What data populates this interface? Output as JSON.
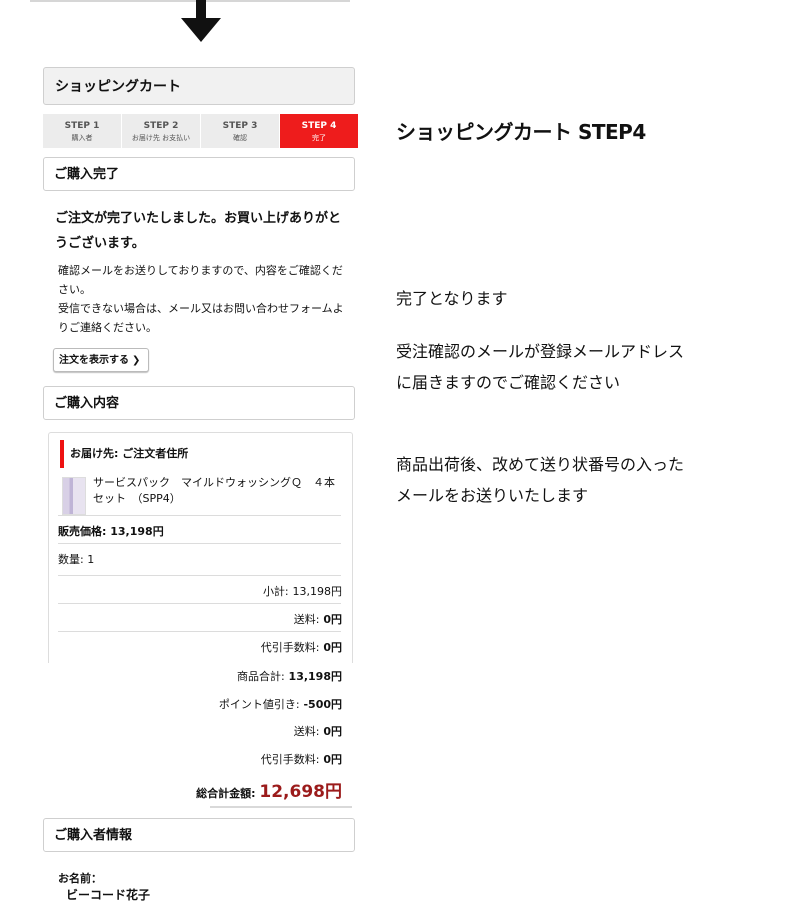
{
  "cart": {
    "header": "ショッピングカート"
  },
  "steps": [
    {
      "num": "STEP 1",
      "sub": "購入者"
    },
    {
      "num": "STEP 2",
      "sub": "お届け先 お支払い"
    },
    {
      "num": "STEP 3",
      "sub": "確認"
    },
    {
      "num": "STEP 4",
      "sub": "完了"
    }
  ],
  "complete": {
    "header": "ご購入完了",
    "thanks": "ご注文が完了いたしました。お買い上げありがとうございます。",
    "notice1": "確認メールをお送りしておりますので、内容をご確認ください。",
    "notice2": "受信できない場合は、メール又はお問い合わせフォームよりご連絡ください。",
    "view_button": "注文を表示する"
  },
  "content": {
    "header": "ご購入内容",
    "ship_to": "お届け先: ご注文者住所",
    "product_name": "サービスパック　マイルドウォッシングＱ　４本セット　（SPP4）",
    "price_label": "販売価格:",
    "price_value": "13,198円",
    "qty_label": "数量:",
    "qty_value": "1",
    "subtotal_label": "小計:",
    "subtotal_value": "13,198円",
    "shipping_label": "送料:",
    "shipping_value": "0円",
    "cod_label": "代引手数料:",
    "cod_value": "0円"
  },
  "totals": {
    "goods_label": "商品合計:",
    "goods_value": "13,198円",
    "points_label": "ポイント値引き:",
    "points_value": "-500円",
    "shipping_label": "送料:",
    "shipping_value": "0円",
    "cod_label": "代引手数料:",
    "cod_value": "0円",
    "grand_label": "総合計金額:",
    "grand_value": "12,698円"
  },
  "buyer": {
    "header": "ご購入者情報",
    "name_label": "お名前：",
    "name_value": "ビーコード花子"
  },
  "side": {
    "title": "ショッピングカート STEP4",
    "line1": "完了となります",
    "line2a": "受注確認のメールが登録メールアドレス",
    "line2b": "に届きますのでご確認ください",
    "line3a": "商品出荷後、改めて送り状番号の入った",
    "line3b": "メールをお送りいたします"
  },
  "colors": {
    "accent": "#ee1c1c",
    "total": "#9b1b1b"
  },
  "icons": {
    "arrow": "arrow-down-icon",
    "chevron": "chevron-right-icon"
  }
}
